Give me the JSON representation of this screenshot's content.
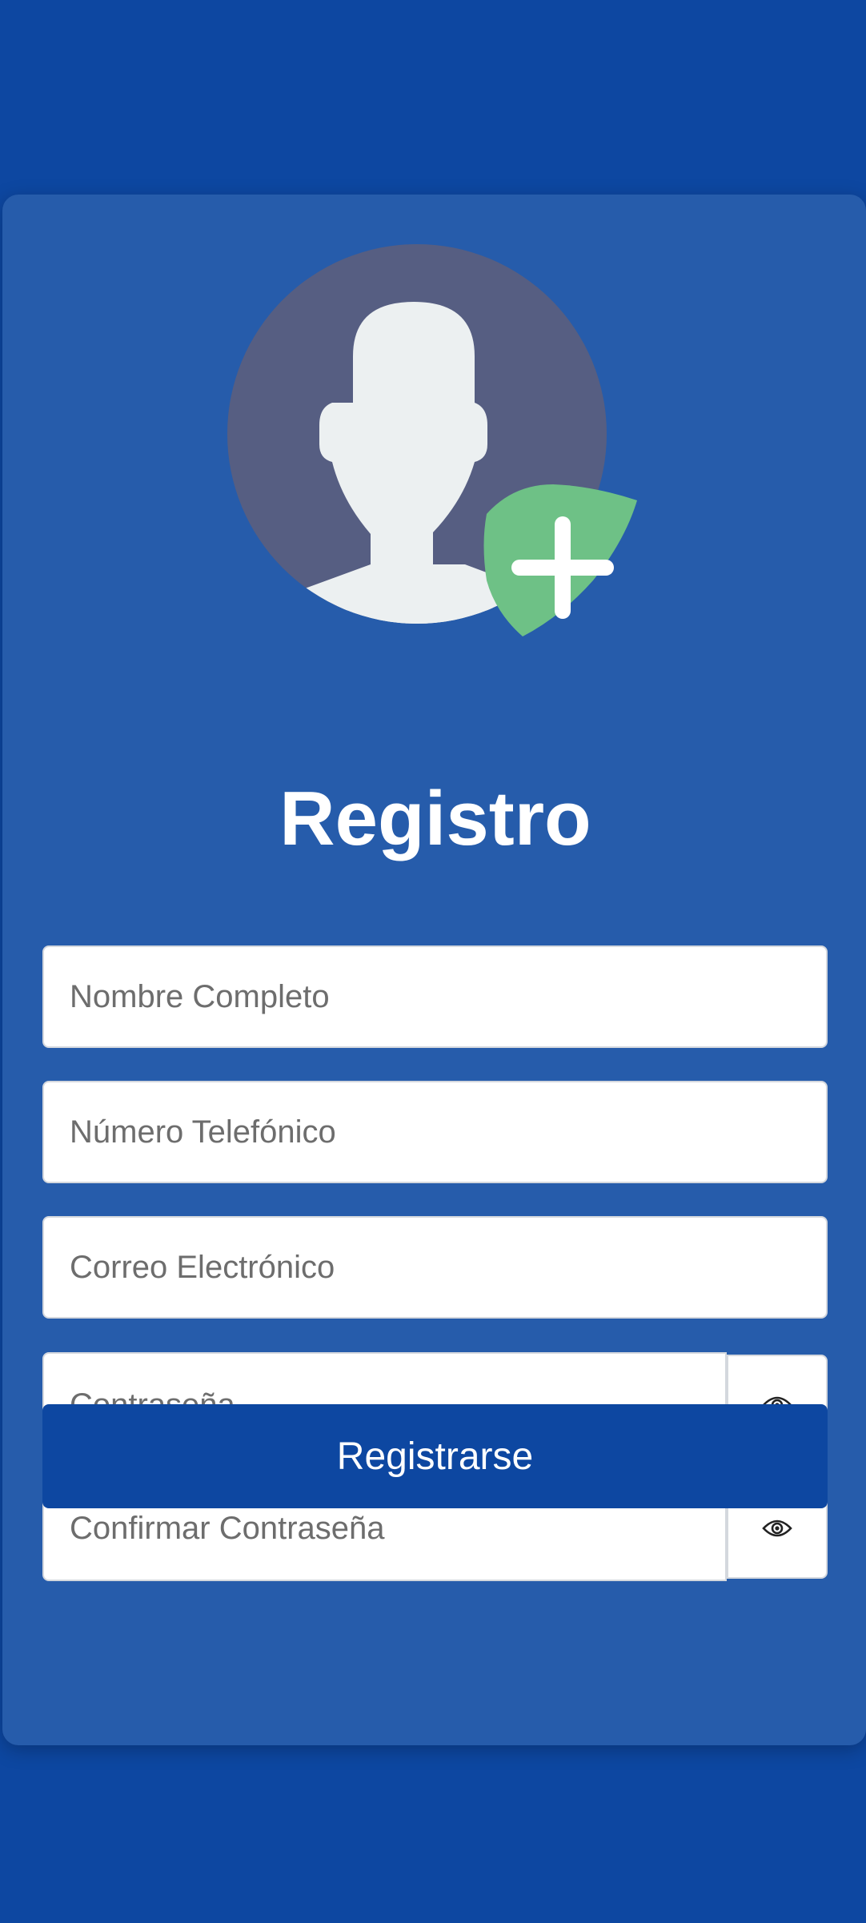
{
  "page": {
    "title": "Registro"
  },
  "form": {
    "full_name": {
      "placeholder": "Nombre Completo",
      "value": ""
    },
    "phone": {
      "placeholder": "Número Telefónico",
      "value": ""
    },
    "email": {
      "placeholder": "Correo Electrónico",
      "value": ""
    },
    "password": {
      "placeholder": "Contraseña",
      "value": ""
    },
    "confirm_password": {
      "placeholder": "Confirmar Contraseña",
      "value": ""
    },
    "submit_label": "Registrarse"
  },
  "icons": {
    "avatar": "add-user-avatar-icon",
    "add": "plus-icon",
    "password_toggle": "eye-icon",
    "confirm_toggle": "eye-icon"
  },
  "colors": {
    "background": "#0d47a1",
    "card": "#265cab",
    "avatar_circle": "#565e82",
    "avatar_silhouette": "#ecf0f1",
    "add_badge": "#6ec186",
    "button": "#0d47a1"
  }
}
